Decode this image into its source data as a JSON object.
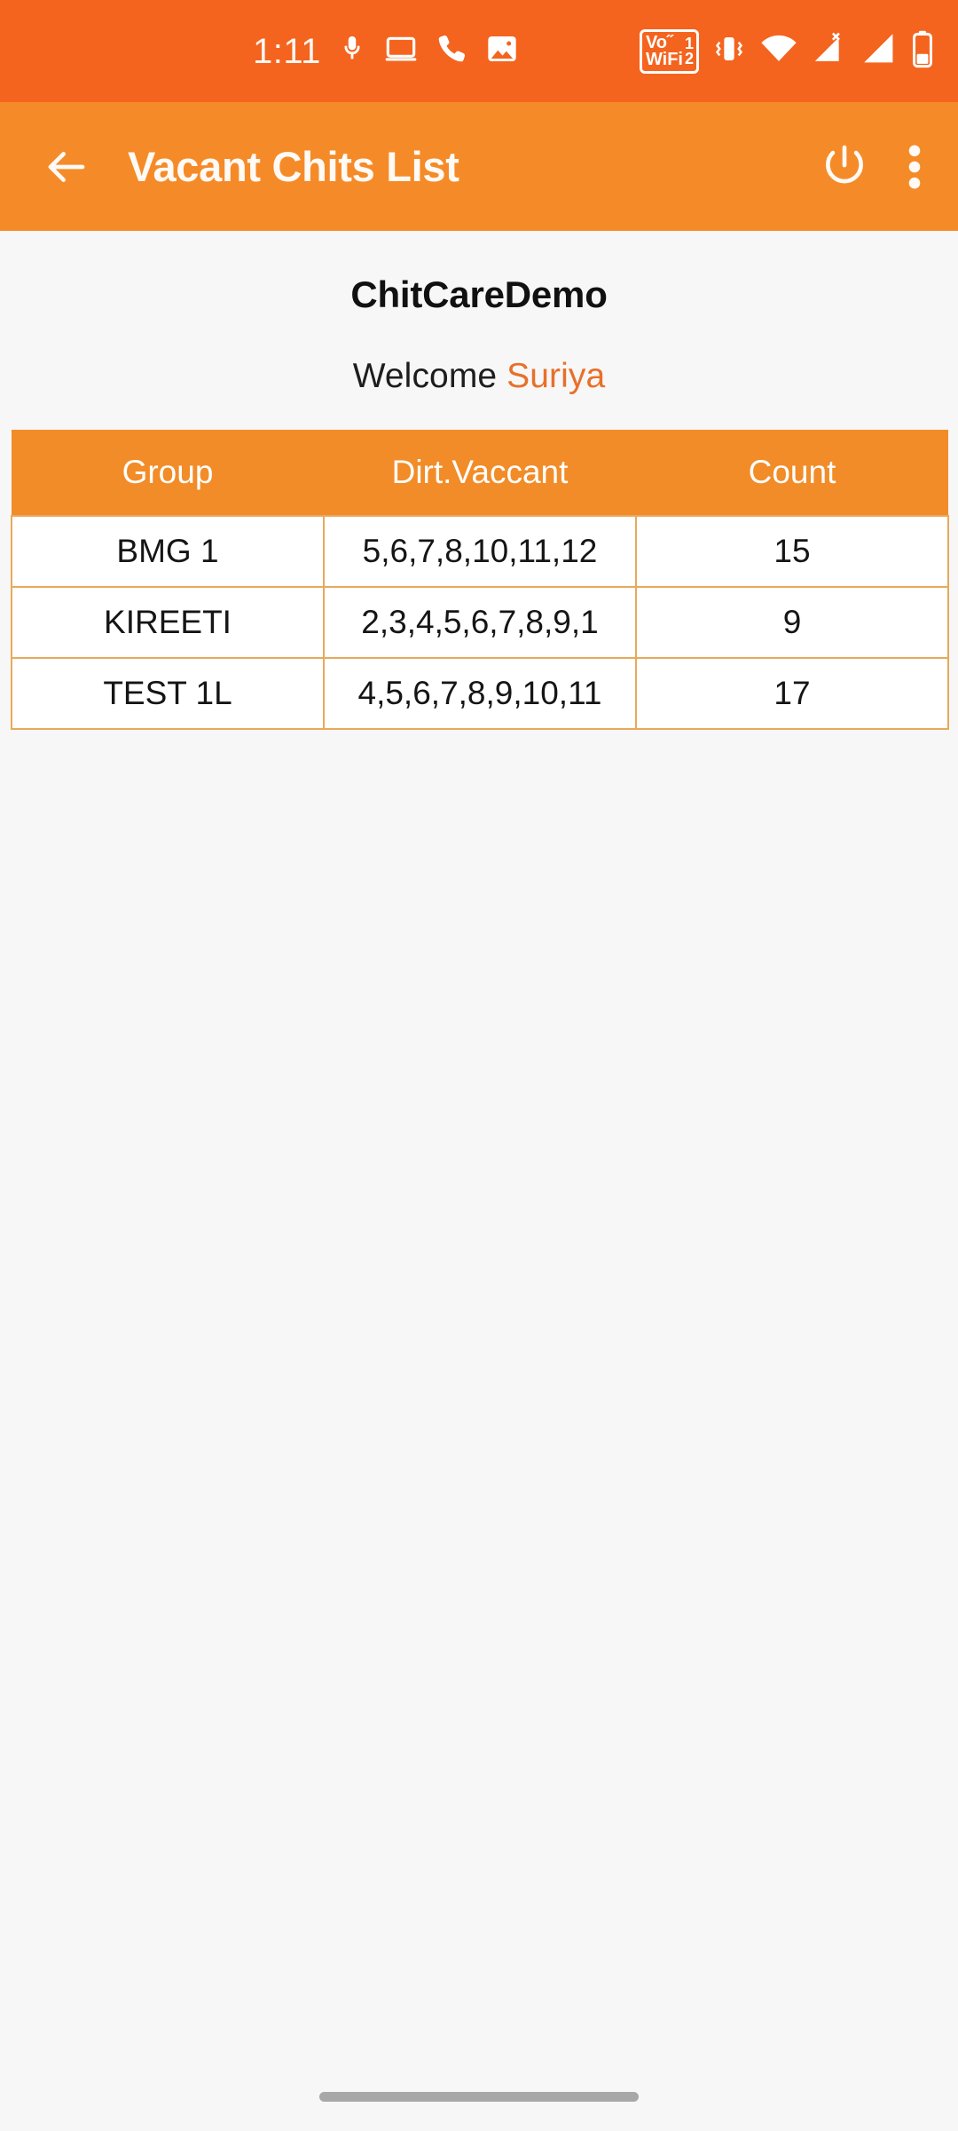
{
  "status_bar": {
    "background": "#f4641e",
    "clock": "1:11",
    "notification_icons": [
      {
        "name": "microphone-icon",
        "label": "Microphone active"
      },
      {
        "name": "laptop-icon",
        "label": "Connected device"
      },
      {
        "name": "phone-icon",
        "label": "Phone call"
      },
      {
        "name": "image-icon",
        "label": "Screenshot saved"
      }
    ],
    "system_icons": [
      {
        "name": "vowifi-icon",
        "label": "VoWiFi",
        "line1": "Vo˝",
        "line2": "WiFi",
        "sim1": "1",
        "sim2": "2"
      },
      {
        "name": "vibrate-icon",
        "label": "Vibrate mode"
      },
      {
        "name": "wifi-icon",
        "label": "Wi-Fi connected"
      },
      {
        "name": "signal-no-service-icon",
        "label": "No service SIM 1"
      },
      {
        "name": "signal-bars-icon",
        "label": "Mobile signal SIM 2"
      },
      {
        "name": "battery-icon",
        "label": "Battery"
      }
    ]
  },
  "app_bar": {
    "background": "#f58b28",
    "title": "Vacant Chits List",
    "back_icon": "arrow-left-icon",
    "power_icon": "power-icon",
    "overflow_icon": "more-vertical-icon"
  },
  "main": {
    "brand_title": "ChitCareDemo",
    "welcome_prefix": "Welcome",
    "welcome_user": "Suriya",
    "accent_color": "#e8702a",
    "table": {
      "header_background": "#f28c28",
      "border_color": "#e8a95c",
      "columns": [
        "Group",
        "Dirt.Vaccant",
        "Count"
      ],
      "rows": [
        {
          "group": "BMG 1",
          "dirt_vaccant": "5,6,7,8,10,11,12",
          "count": "15"
        },
        {
          "group": "KIREETI",
          "dirt_vaccant": "2,3,4,5,6,7,8,9,1",
          "count": "9"
        },
        {
          "group": "TEST 1L",
          "dirt_vaccant": "4,5,6,7,8,9,10,11",
          "count": "17"
        }
      ]
    }
  },
  "nav_bar": {
    "handle": "home-gesture-handle"
  }
}
